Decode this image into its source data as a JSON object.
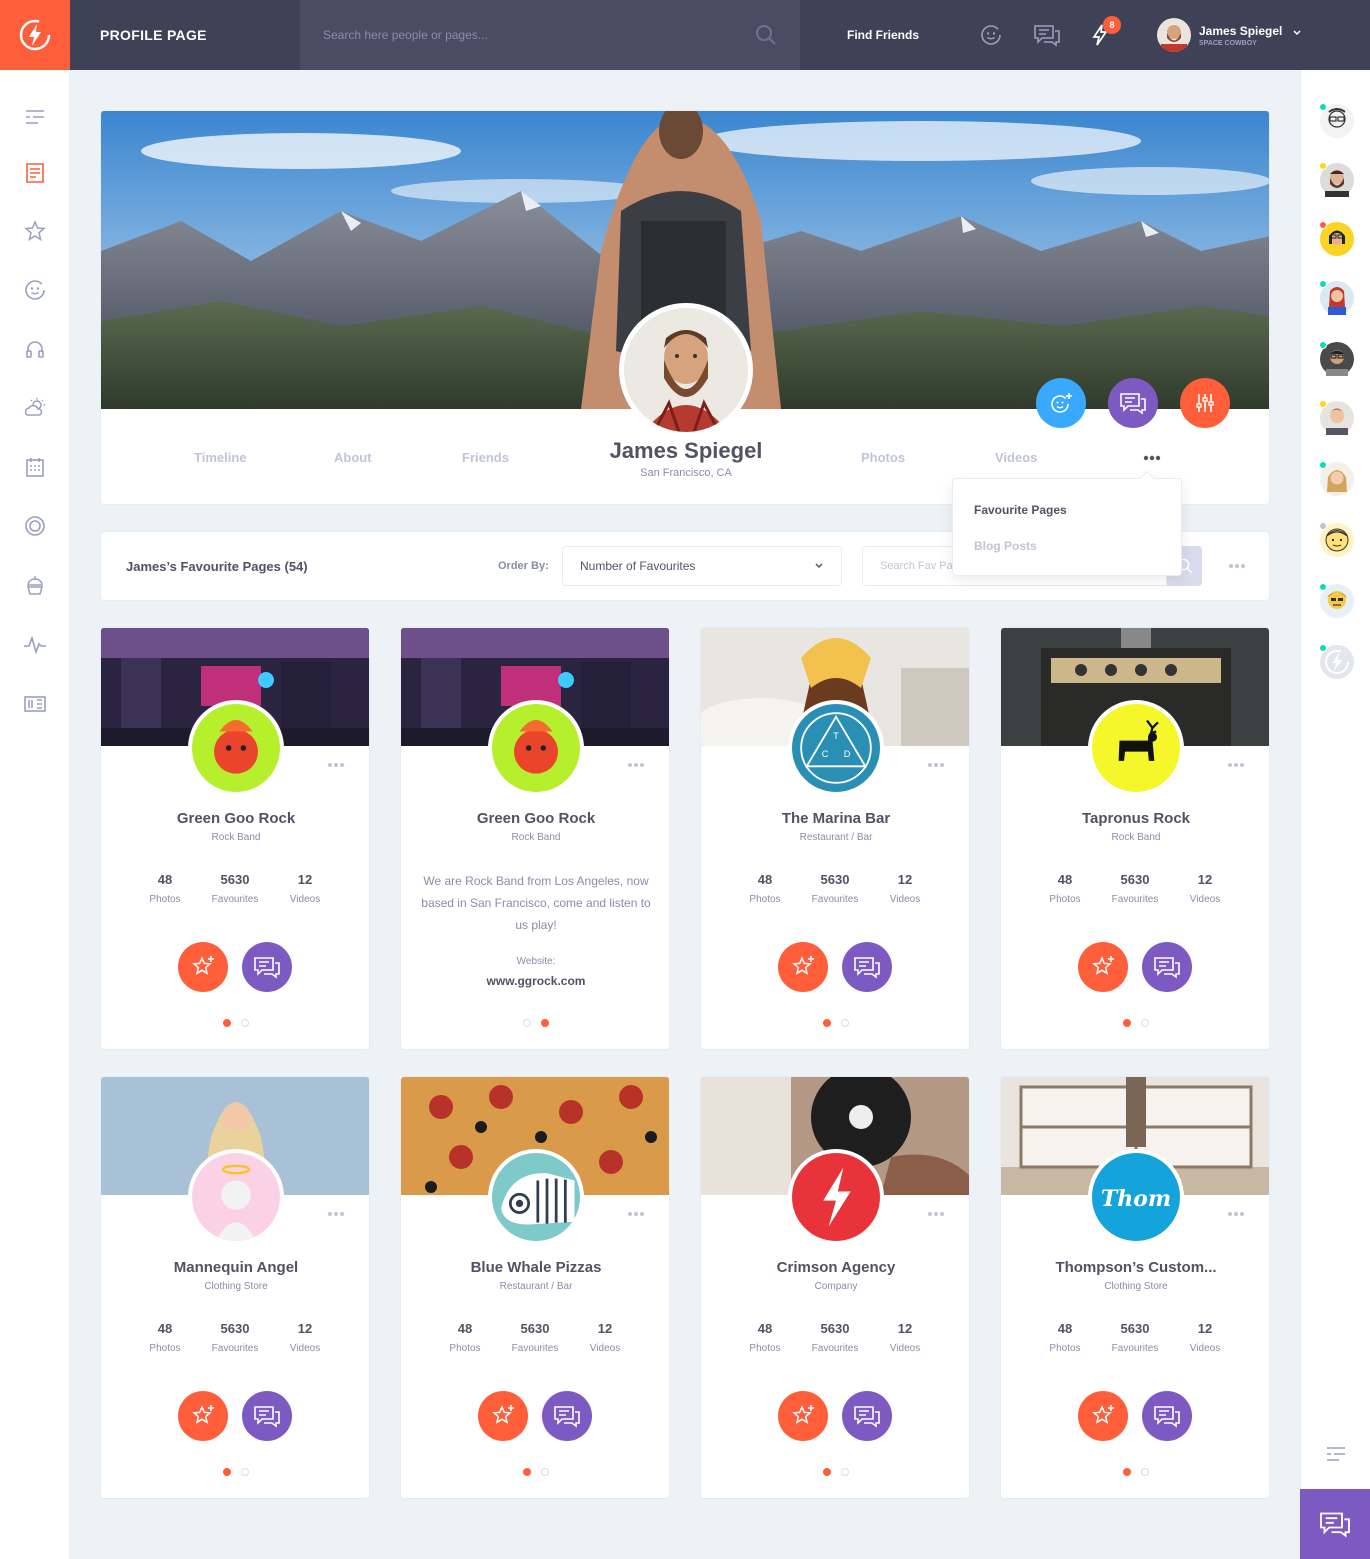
{
  "header": {
    "page_title": "PROFILE PAGE",
    "search_placeholder": "Search here people or pages...",
    "find_friends": "Find Friends",
    "notifications_count": "8",
    "user_name": "James Spiegel",
    "user_status": "SPACE COWBOY"
  },
  "profile": {
    "name": "James Spiegel",
    "location": "San Francisco, CA",
    "tabs": [
      "Timeline",
      "About",
      "Friends",
      "Photos",
      "Videos"
    ]
  },
  "dropdown": {
    "items": [
      "Favourite Pages",
      "Blog Posts"
    ]
  },
  "filter": {
    "title": "James’s Favourite Pages (54)",
    "order_label": "Order By:",
    "order_value": "Number of Favourites",
    "search_placeholder": "Search Fav Pages..."
  },
  "cards": [
    {
      "name": "Green Goo Rock",
      "type": "Rock Band",
      "stats": [
        {
          "num": "48",
          "label": "Photos"
        },
        {
          "num": "5630",
          "label": "Favourites"
        },
        {
          "num": "12",
          "label": "Videos"
        }
      ]
    },
    {
      "name": "Green Goo Rock",
      "type": "Rock Band",
      "description": "We are Rock Band from Los Angeles, now based in San Francisco, come and listen to us play!",
      "website_label": "Website:",
      "website": "www.ggrock.com"
    },
    {
      "name": "The Marina Bar",
      "type": "Restaurant / Bar",
      "stats": [
        {
          "num": "48",
          "label": "Photos"
        },
        {
          "num": "5630",
          "label": "Favourites"
        },
        {
          "num": "12",
          "label": "Videos"
        }
      ]
    },
    {
      "name": "Tapronus Rock",
      "type": "Rock Band",
      "stats": [
        {
          "num": "48",
          "label": "Photos"
        },
        {
          "num": "5630",
          "label": "Favourites"
        },
        {
          "num": "12",
          "label": "Videos"
        }
      ]
    },
    {
      "name": "Mannequin Angel",
      "type": "Clothing Store",
      "stats": [
        {
          "num": "48",
          "label": "Photos"
        },
        {
          "num": "5630",
          "label": "Favourites"
        },
        {
          "num": "12",
          "label": "Videos"
        }
      ]
    },
    {
      "name": "Blue Whale Pizzas",
      "type": "Restaurant / Bar",
      "stats": [
        {
          "num": "48",
          "label": "Photos"
        },
        {
          "num": "5630",
          "label": "Favourites"
        },
        {
          "num": "12",
          "label": "Videos"
        }
      ]
    },
    {
      "name": "Crimson Agency",
      "type": "Company",
      "stats": [
        {
          "num": "48",
          "label": "Photos"
        },
        {
          "num": "5630",
          "label": "Favourites"
        },
        {
          "num": "12",
          "label": "Videos"
        }
      ]
    },
    {
      "name": "Thompson’s Custom...",
      "type": "Clothing Store",
      "logo_text": "Thom",
      "stats": [
        {
          "num": "48",
          "label": "Photos"
        },
        {
          "num": "5630",
          "label": "Favourites"
        },
        {
          "num": "12",
          "label": "Videos"
        }
      ]
    }
  ],
  "colors": {
    "accent": "#ff5e3a",
    "purple": "#7c5ac2",
    "blue": "#38a9ff",
    "topbar": "#3f4257"
  }
}
